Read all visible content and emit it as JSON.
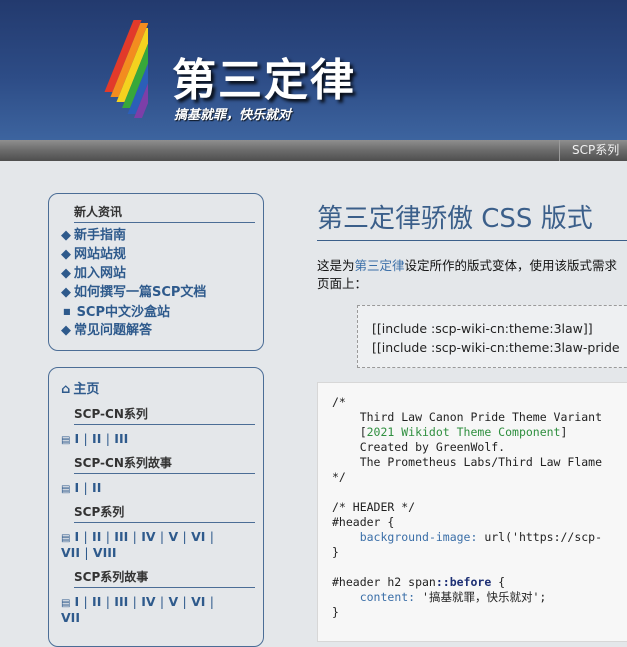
{
  "colors": {
    "header_top": "#233a6e",
    "header_bottom": "#3d649f",
    "link": "#2e5a8c",
    "title": "#3b5f8a"
  },
  "header": {
    "title": "第三定律",
    "subtitle": "搞基就罪，快乐就对",
    "logo_icon": "rainbow-stripes-icon"
  },
  "topbar": {
    "menu_item": "SCP系列"
  },
  "sidebar": {
    "box1": {
      "heading": "新人资讯",
      "bullet_icon": "diamond-bullet-icon",
      "links": [
        "新手指南",
        "网站站规",
        "加入网站",
        "如何撰写一篇SCP文档",
        "SCP中文沙盒站",
        "常见问题解答"
      ]
    },
    "box2": {
      "home": "主页",
      "home_icon": "home-icon",
      "doc_icon": "document-icon",
      "sections": [
        {
          "heading": "SCP-CN系列",
          "rows": [
            [
              "I",
              "II",
              "III"
            ]
          ]
        },
        {
          "heading": "SCP-CN系列故事",
          "rows": [
            [
              "I",
              "II"
            ]
          ]
        },
        {
          "heading": "SCP系列",
          "rows": [
            [
              "I",
              "II",
              "III",
              "IV",
              "V",
              "VI"
            ],
            [
              "VII",
              "VIII"
            ]
          ]
        },
        {
          "heading": "SCP系列故事",
          "rows": [
            [
              "I",
              "II",
              "III",
              "IV",
              "V",
              "VI"
            ],
            [
              "VII"
            ]
          ]
        }
      ]
    }
  },
  "main": {
    "title": "第三定律骄傲 CSS 版式",
    "intro_pre": "这是为",
    "intro_link": "第三定律",
    "intro_post": "设定所作的版式变体，使用该版式需求",
    "intro_line2": "页面上：",
    "include_lines": [
      "[[include :scp-wiki-cn:theme:3law]]",
      "[[include :scp-wiki-cn:theme:3law-pride"
    ],
    "code": {
      "l1": "/*",
      "l2": "    Third Law Canon Pride Theme Variant",
      "l3_pre": "    [",
      "l3_link": "2021 Wikidot Theme Component",
      "l3_post": "]",
      "l4": "    Created by GreenWolf.",
      "l5": "    The Prometheus Labs/Third Law Flame",
      "l6": "*/",
      "l8": "/* HEADER */",
      "l9": "#header {",
      "l10_prop": "background-image:",
      "l10_val": " url('https://scp-",
      "l11": "}",
      "l13_pre": "#header h2 span",
      "l13_kw": "::before",
      "l13_post": " {",
      "l14_prop": "content:",
      "l14_val": " '搞基就罪，快乐就对';",
      "l15": "}"
    }
  }
}
